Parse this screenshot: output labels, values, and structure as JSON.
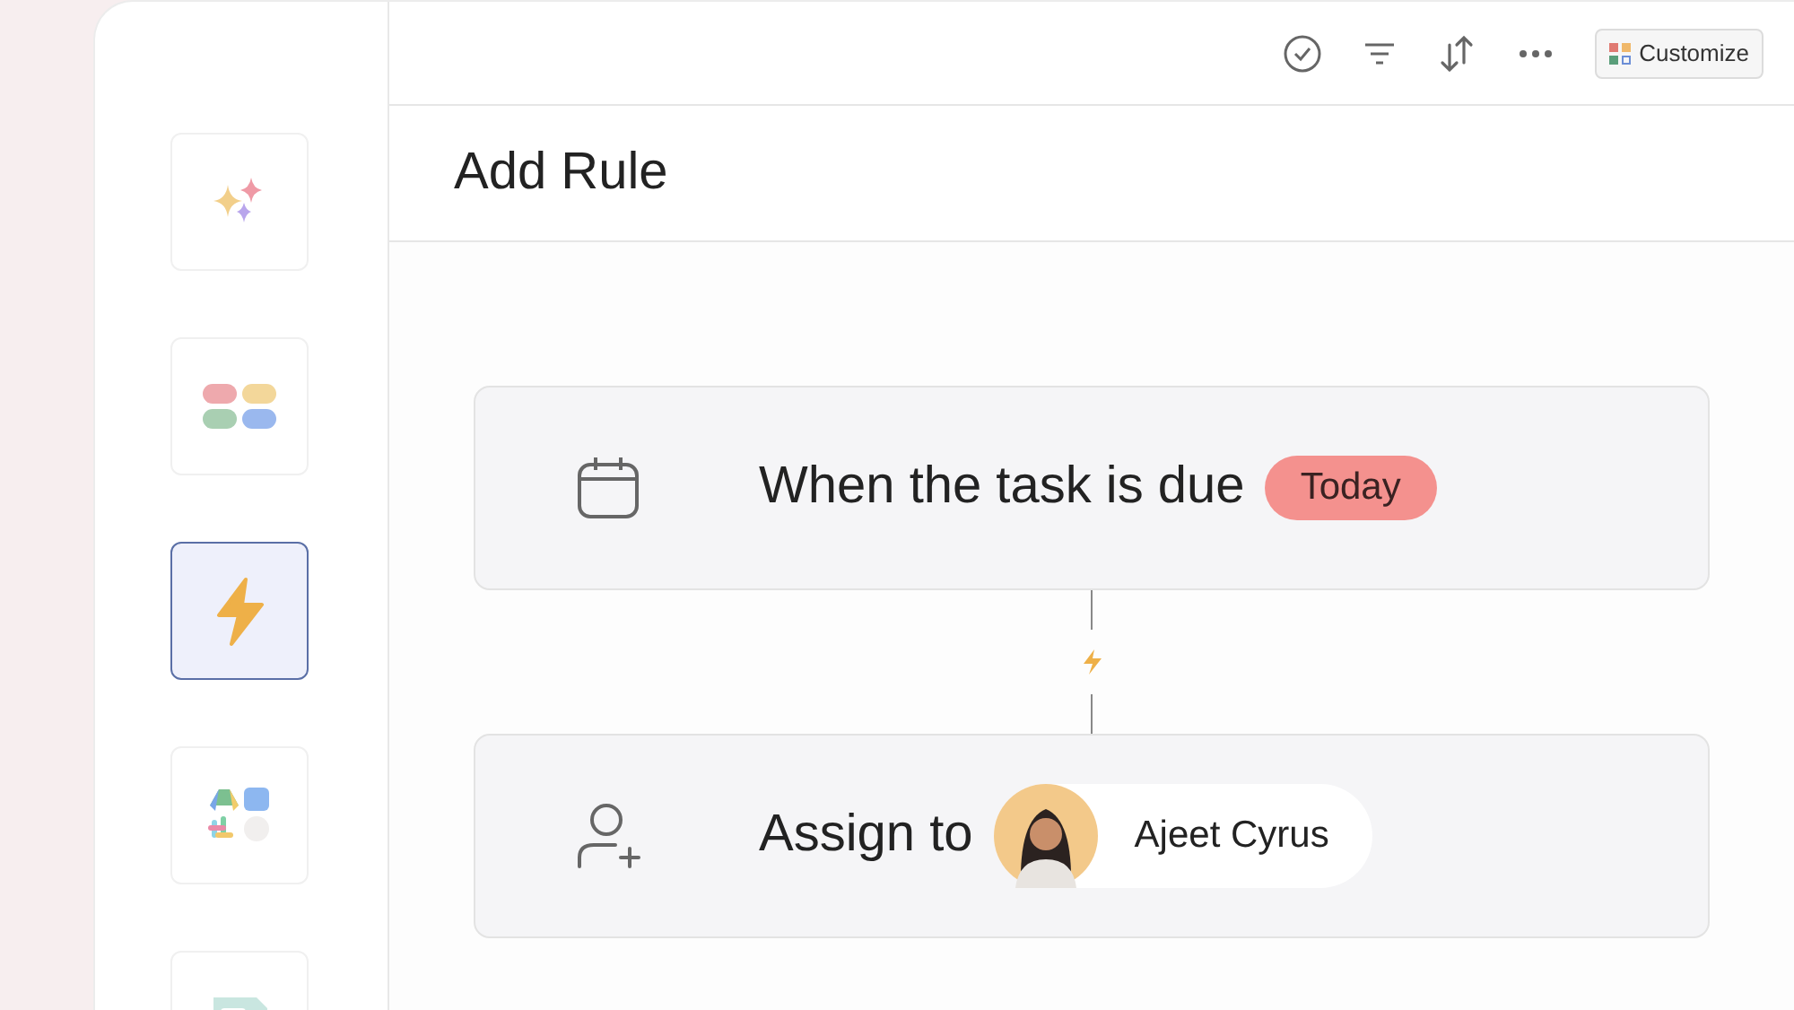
{
  "sidebar": {
    "tiles": [
      {
        "kind": "sparkles",
        "selected": false
      },
      {
        "kind": "pills",
        "selected": false
      },
      {
        "kind": "bolt",
        "selected": true
      },
      {
        "kind": "apps",
        "selected": false
      },
      {
        "kind": "form",
        "selected": false
      }
    ]
  },
  "toolbar": {
    "customize_button": "Customize"
  },
  "title": "Add Rule",
  "rules": [
    {
      "kind": "trigger",
      "text": "When the task is due",
      "badge": "Today"
    },
    {
      "kind": "action",
      "text": "Assign to",
      "assignee": "Ajeet Cyrus"
    }
  ]
}
